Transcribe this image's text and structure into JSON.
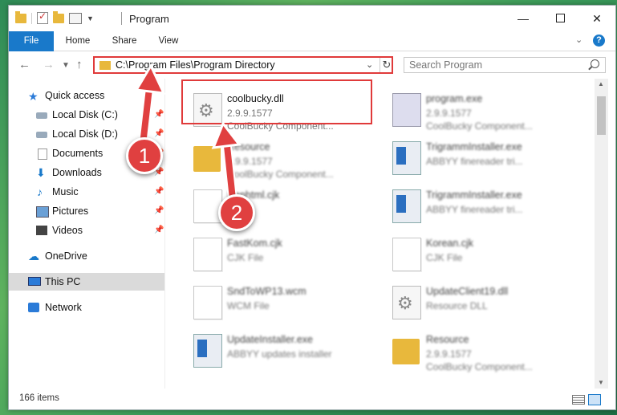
{
  "window": {
    "title": "Program"
  },
  "ribbon": {
    "tabs": [
      "File",
      "Home",
      "Share",
      "View"
    ],
    "help": "?"
  },
  "nav": {
    "address": "C:\\Program Files\\Program Directory",
    "search_placeholder": "Search Program"
  },
  "sidebar": {
    "items": [
      {
        "label": "Quick access",
        "icon": "star-icon",
        "pinned": false
      },
      {
        "label": "Local Disk (C:)",
        "icon": "disk-icon",
        "pinned": true
      },
      {
        "label": "Local Disk (D:)",
        "icon": "disk-icon",
        "pinned": true
      },
      {
        "label": "Documents",
        "icon": "document-icon",
        "pinned": true
      },
      {
        "label": "Downloads",
        "icon": "download-icon",
        "pinned": true
      },
      {
        "label": "Music",
        "icon": "music-icon",
        "pinned": true
      },
      {
        "label": "Pictures",
        "icon": "pictures-icon",
        "pinned": true
      },
      {
        "label": "Videos",
        "icon": "videos-icon",
        "pinned": true
      },
      {
        "label": "OneDrive",
        "icon": "cloud-icon",
        "pinned": false
      },
      {
        "label": "This PC",
        "icon": "pc-icon",
        "pinned": false,
        "selected": true
      },
      {
        "label": "Network",
        "icon": "network-icon",
        "pinned": false
      }
    ]
  },
  "files": [
    {
      "name": "coolbucky.dll",
      "version": "2.9.9.1577",
      "desc": "CoolBucky Component...",
      "icon": "gear-file-icon"
    },
    {
      "name": "program.exe",
      "version": "2.9.9.1577",
      "desc": "CoolBucky Component...",
      "icon": "exe-icon"
    },
    {
      "name": "Resource",
      "version": "2.9.9.1577",
      "desc": "CoolBucky Component...",
      "icon": "folder-icon"
    },
    {
      "name": "TrigrammInstaller.exe",
      "version": "",
      "desc": "ABBYY finereader tri...",
      "icon": "app-icon"
    },
    {
      "name": "Danhtml.cjk",
      "version": "",
      "desc": "",
      "icon": "file-icon"
    },
    {
      "name": "TrigrammInstaller.exe",
      "version": "",
      "desc": "ABBYY finereader tri...",
      "icon": "app-icon"
    },
    {
      "name": "FastKom.cjk",
      "version": "CJK File",
      "desc": "",
      "icon": "file-icon"
    },
    {
      "name": "Korean.cjk",
      "version": "CJK File",
      "desc": "",
      "icon": "file-icon"
    },
    {
      "name": "SndToWP13.wcm",
      "version": "WCM File",
      "desc": "",
      "icon": "file-icon"
    },
    {
      "name": "UpdateClient19.dll",
      "version": "Resource DLL",
      "desc": "",
      "icon": "gear-file-icon"
    },
    {
      "name": "UpdateInstaller.exe",
      "version": "ABBYY updates installer",
      "desc": "",
      "icon": "app-icon"
    },
    {
      "name": "Resource",
      "version": "2.9.9.1577",
      "desc": "CoolBucky Component...",
      "icon": "folder-icon"
    }
  ],
  "status": {
    "count": "166 items"
  },
  "annotations": {
    "step1": "1",
    "step2": "2",
    "accent": "#e03a3a"
  }
}
